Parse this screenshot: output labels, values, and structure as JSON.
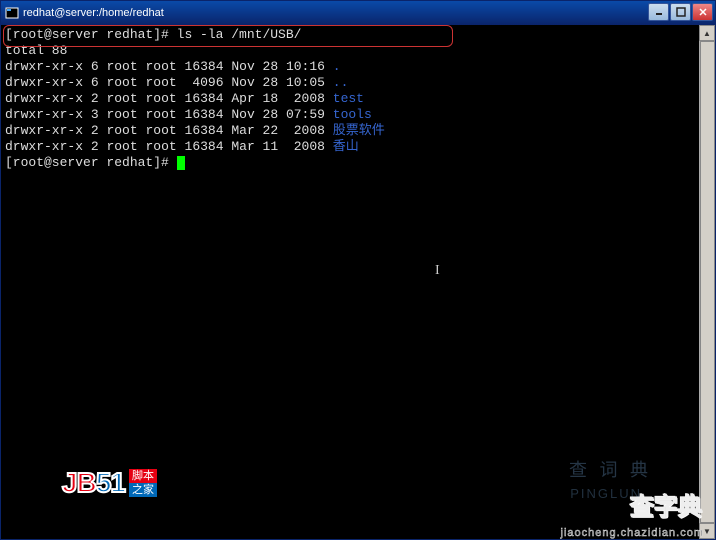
{
  "title": "redhat@server:/home/redhat",
  "prompt1": "[root@server redhat]# ",
  "command": "ls -la /mnt/USB/",
  "total_line": "total 88",
  "listing": [
    {
      "perms": "drwxr-xr-x",
      "links": "6",
      "owner": "root",
      "group": "root",
      "size": "16384",
      "date": "Nov 28 10:16",
      "name": ".",
      "color": "blue"
    },
    {
      "perms": "drwxr-xr-x",
      "links": "6",
      "owner": "root",
      "group": "root",
      "size": " 4096",
      "date": "Nov 28 10:05",
      "name": "..",
      "color": "blue"
    },
    {
      "perms": "drwxr-xr-x",
      "links": "2",
      "owner": "root",
      "group": "root",
      "size": "16384",
      "date": "Apr 18  2008",
      "name": "test",
      "color": "blue"
    },
    {
      "perms": "drwxr-xr-x",
      "links": "3",
      "owner": "root",
      "group": "root",
      "size": "16384",
      "date": "Nov 28 07:59",
      "name": "tools",
      "color": "blue"
    },
    {
      "perms": "drwxr-xr-x",
      "links": "2",
      "owner": "root",
      "group": "root",
      "size": "16384",
      "date": "Mar 22  2008",
      "name": "股票软件",
      "color": "blue"
    },
    {
      "perms": "drwxr-xr-x",
      "links": "2",
      "owner": "root",
      "group": "root",
      "size": "16384",
      "date": "Mar 11  2008",
      "name": "香山",
      "color": "blue"
    }
  ],
  "prompt2": "[root@server redhat]# ",
  "logo": {
    "text": "JB51",
    "side1": "脚本",
    "side2": "之家"
  },
  "wm1": "查 词 典",
  "wm1_sub": "PINGLUN",
  "wm2": "查字典",
  "wm2_sub": "jiaocheng.chazidian.com"
}
